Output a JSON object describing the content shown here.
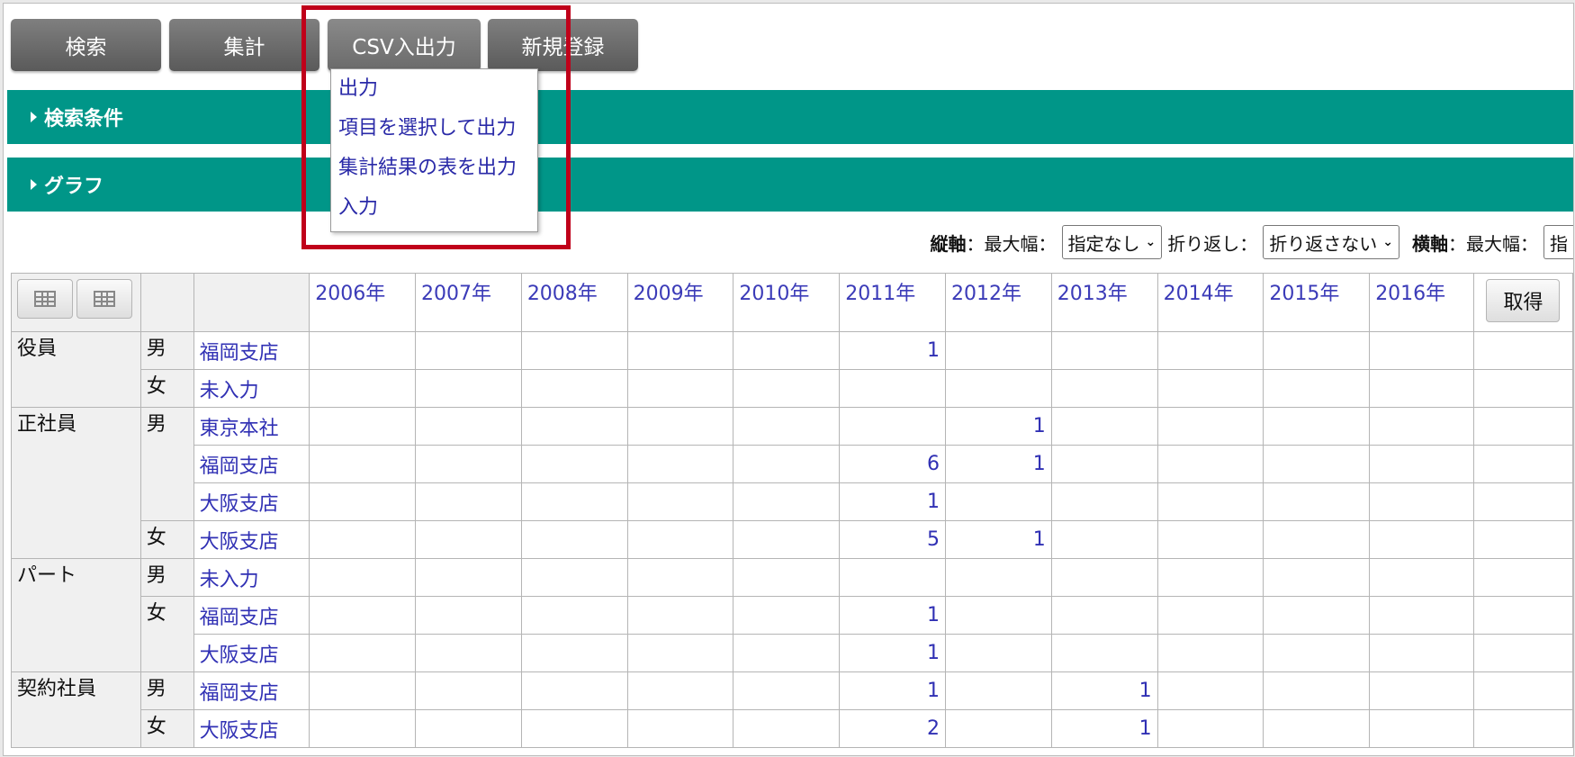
{
  "toolbar": {
    "search": "検索",
    "aggregate": "集計",
    "csv": "CSV入出力",
    "new": "新規登録"
  },
  "menu": {
    "items": [
      "出力",
      "項目を選択して出力",
      "集計結果の表を出力",
      "入力"
    ]
  },
  "panels": {
    "search_conditions": "検索条件",
    "graph": "グラフ"
  },
  "controls": {
    "vertical_label": "縦軸",
    "max_width_label": "：最大幅：",
    "vertical_max_width": "指定なし",
    "wrap_label": "折り返し：",
    "wrap_value": "折り返さない",
    "horizontal_label": "横軸",
    "horizontal_max_width_label": "：最大幅：",
    "horizontal_max_width": "指"
  },
  "table": {
    "years": [
      "2006年",
      "2007年",
      "2008年",
      "2009年",
      "2010年",
      "2011年",
      "2012年",
      "2013年",
      "2014年",
      "2015年",
      "2016年"
    ],
    "get_button": "取得",
    "rows": [
      {
        "category": "役員",
        "gender": "男",
        "branch": "福岡支店",
        "values": [
          "",
          "",
          "",
          "",
          "",
          "1",
          "",
          "",
          "",
          "",
          ""
        ]
      },
      {
        "category": "",
        "gender": "女",
        "branch": "未入力",
        "values": [
          "",
          "",
          "",
          "",
          "",
          "",
          "",
          "",
          "",
          "",
          ""
        ]
      },
      {
        "category": "正社員",
        "gender": "男",
        "branch": "東京本社",
        "values": [
          "",
          "",
          "",
          "",
          "",
          "",
          "1",
          "",
          "",
          "",
          ""
        ]
      },
      {
        "category": "",
        "gender": "",
        "branch": "福岡支店",
        "values": [
          "",
          "",
          "",
          "",
          "",
          "6",
          "1",
          "",
          "",
          "",
          ""
        ]
      },
      {
        "category": "",
        "gender": "",
        "branch": "大阪支店",
        "values": [
          "",
          "",
          "",
          "",
          "",
          "1",
          "",
          "",
          "",
          "",
          ""
        ]
      },
      {
        "category": "",
        "gender": "女",
        "branch": "大阪支店",
        "values": [
          "",
          "",
          "",
          "",
          "",
          "5",
          "1",
          "",
          "",
          "",
          ""
        ]
      },
      {
        "category": "パート",
        "gender": "男",
        "branch": "未入力",
        "values": [
          "",
          "",
          "",
          "",
          "",
          "",
          "",
          "",
          "",
          "",
          ""
        ]
      },
      {
        "category": "",
        "gender": "女",
        "branch": "福岡支店",
        "values": [
          "",
          "",
          "",
          "",
          "",
          "1",
          "",
          "",
          "",
          "",
          ""
        ]
      },
      {
        "category": "",
        "gender": "",
        "branch": "大阪支店",
        "values": [
          "",
          "",
          "",
          "",
          "",
          "1",
          "",
          "",
          "",
          "",
          ""
        ]
      },
      {
        "category": "契約社員",
        "gender": "男",
        "branch": "福岡支店",
        "values": [
          "",
          "",
          "",
          "",
          "",
          "1",
          "",
          "1",
          "",
          "",
          ""
        ]
      },
      {
        "category": "",
        "gender": "女",
        "branch": "大阪支店",
        "values": [
          "",
          "",
          "",
          "",
          "",
          "2",
          "",
          "1",
          "",
          "",
          ""
        ]
      }
    ]
  }
}
